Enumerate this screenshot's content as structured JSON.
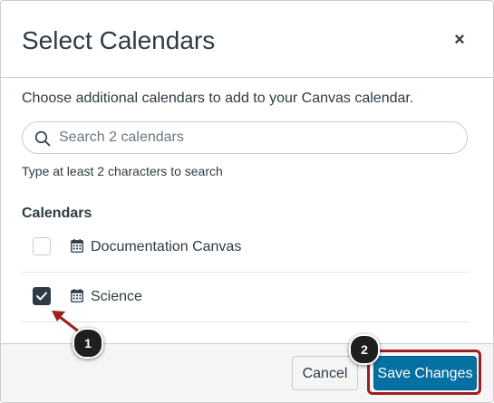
{
  "dialog": {
    "title": "Select Calendars",
    "close_symbol": "×",
    "intro_text": "Choose additional calendars to add to your Canvas calendar."
  },
  "search": {
    "placeholder": "Search 2 calendars",
    "value": "",
    "hint": "Type at least 2 characters to search",
    "icon": "search-icon"
  },
  "calendars": {
    "section_label": "Calendars",
    "items": [
      {
        "label": "Documentation Canvas",
        "checked": false,
        "icon": "calendar-icon"
      },
      {
        "label": "Science",
        "checked": true,
        "icon": "calendar-icon"
      }
    ]
  },
  "footer": {
    "cancel_label": "Cancel",
    "save_label": "Save Changes"
  },
  "annotations": {
    "callout_1": "1",
    "callout_2": "2",
    "highlight_color": "#9b1f23"
  },
  "colors": {
    "primary_button": "#0770a3",
    "text": "#2d3b45",
    "checkbox_checked": "#2d3b45"
  }
}
